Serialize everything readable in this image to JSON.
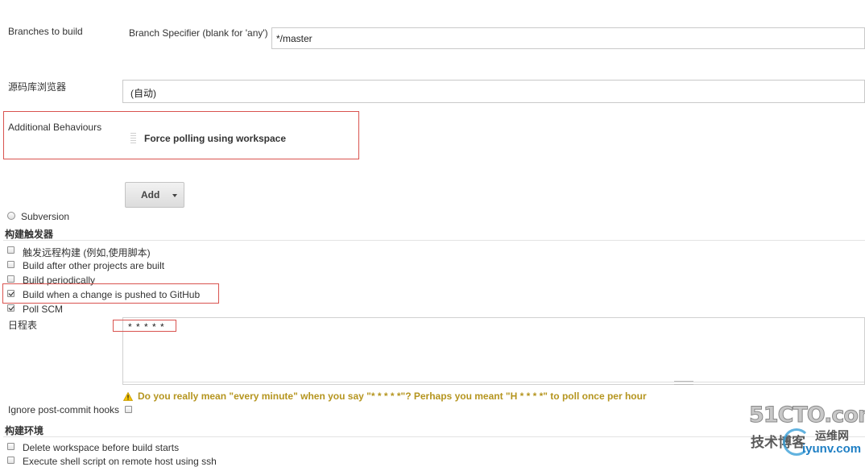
{
  "branches": {
    "label": "Branches to build",
    "specifier_label": "Branch Specifier (blank for 'any')",
    "specifier_value": "*/master"
  },
  "repo_browser": {
    "label": "源码库浏览器",
    "value": "(自动)"
  },
  "additional_behaviours": {
    "label": "Additional Behaviours",
    "item": "Force polling using workspace",
    "add_button": "Add"
  },
  "subversion": {
    "label": "Subversion"
  },
  "triggers": {
    "heading": "构建触发器",
    "items": [
      {
        "label": "触发远程构建 (例如,使用脚本)",
        "checked": false
      },
      {
        "label": "Build after other projects are built",
        "checked": false
      },
      {
        "label": "Build periodically",
        "checked": false
      },
      {
        "label": "Build when a change is pushed to GitHub",
        "checked": true
      },
      {
        "label": "Poll SCM",
        "checked": true
      }
    ]
  },
  "schedule": {
    "label": "日程表",
    "value": "* * * * *",
    "warning": "Do you really mean \"every minute\" when you say \"* * * * *\"? Perhaps you meant \"H * * * *\" to poll once per hour"
  },
  "ignore_hooks": {
    "label": "Ignore post-commit hooks",
    "checked": false
  },
  "environment": {
    "heading": "构建环境",
    "items": [
      {
        "label": "Delete workspace before build starts",
        "checked": false
      },
      {
        "label": "Execute shell script on remote host using ssh",
        "checked": false
      }
    ]
  },
  "watermark": {
    "brand": "51CTO.com",
    "line1": "技术博客",
    "line2": "运维网",
    "site": "iyunv.com"
  }
}
